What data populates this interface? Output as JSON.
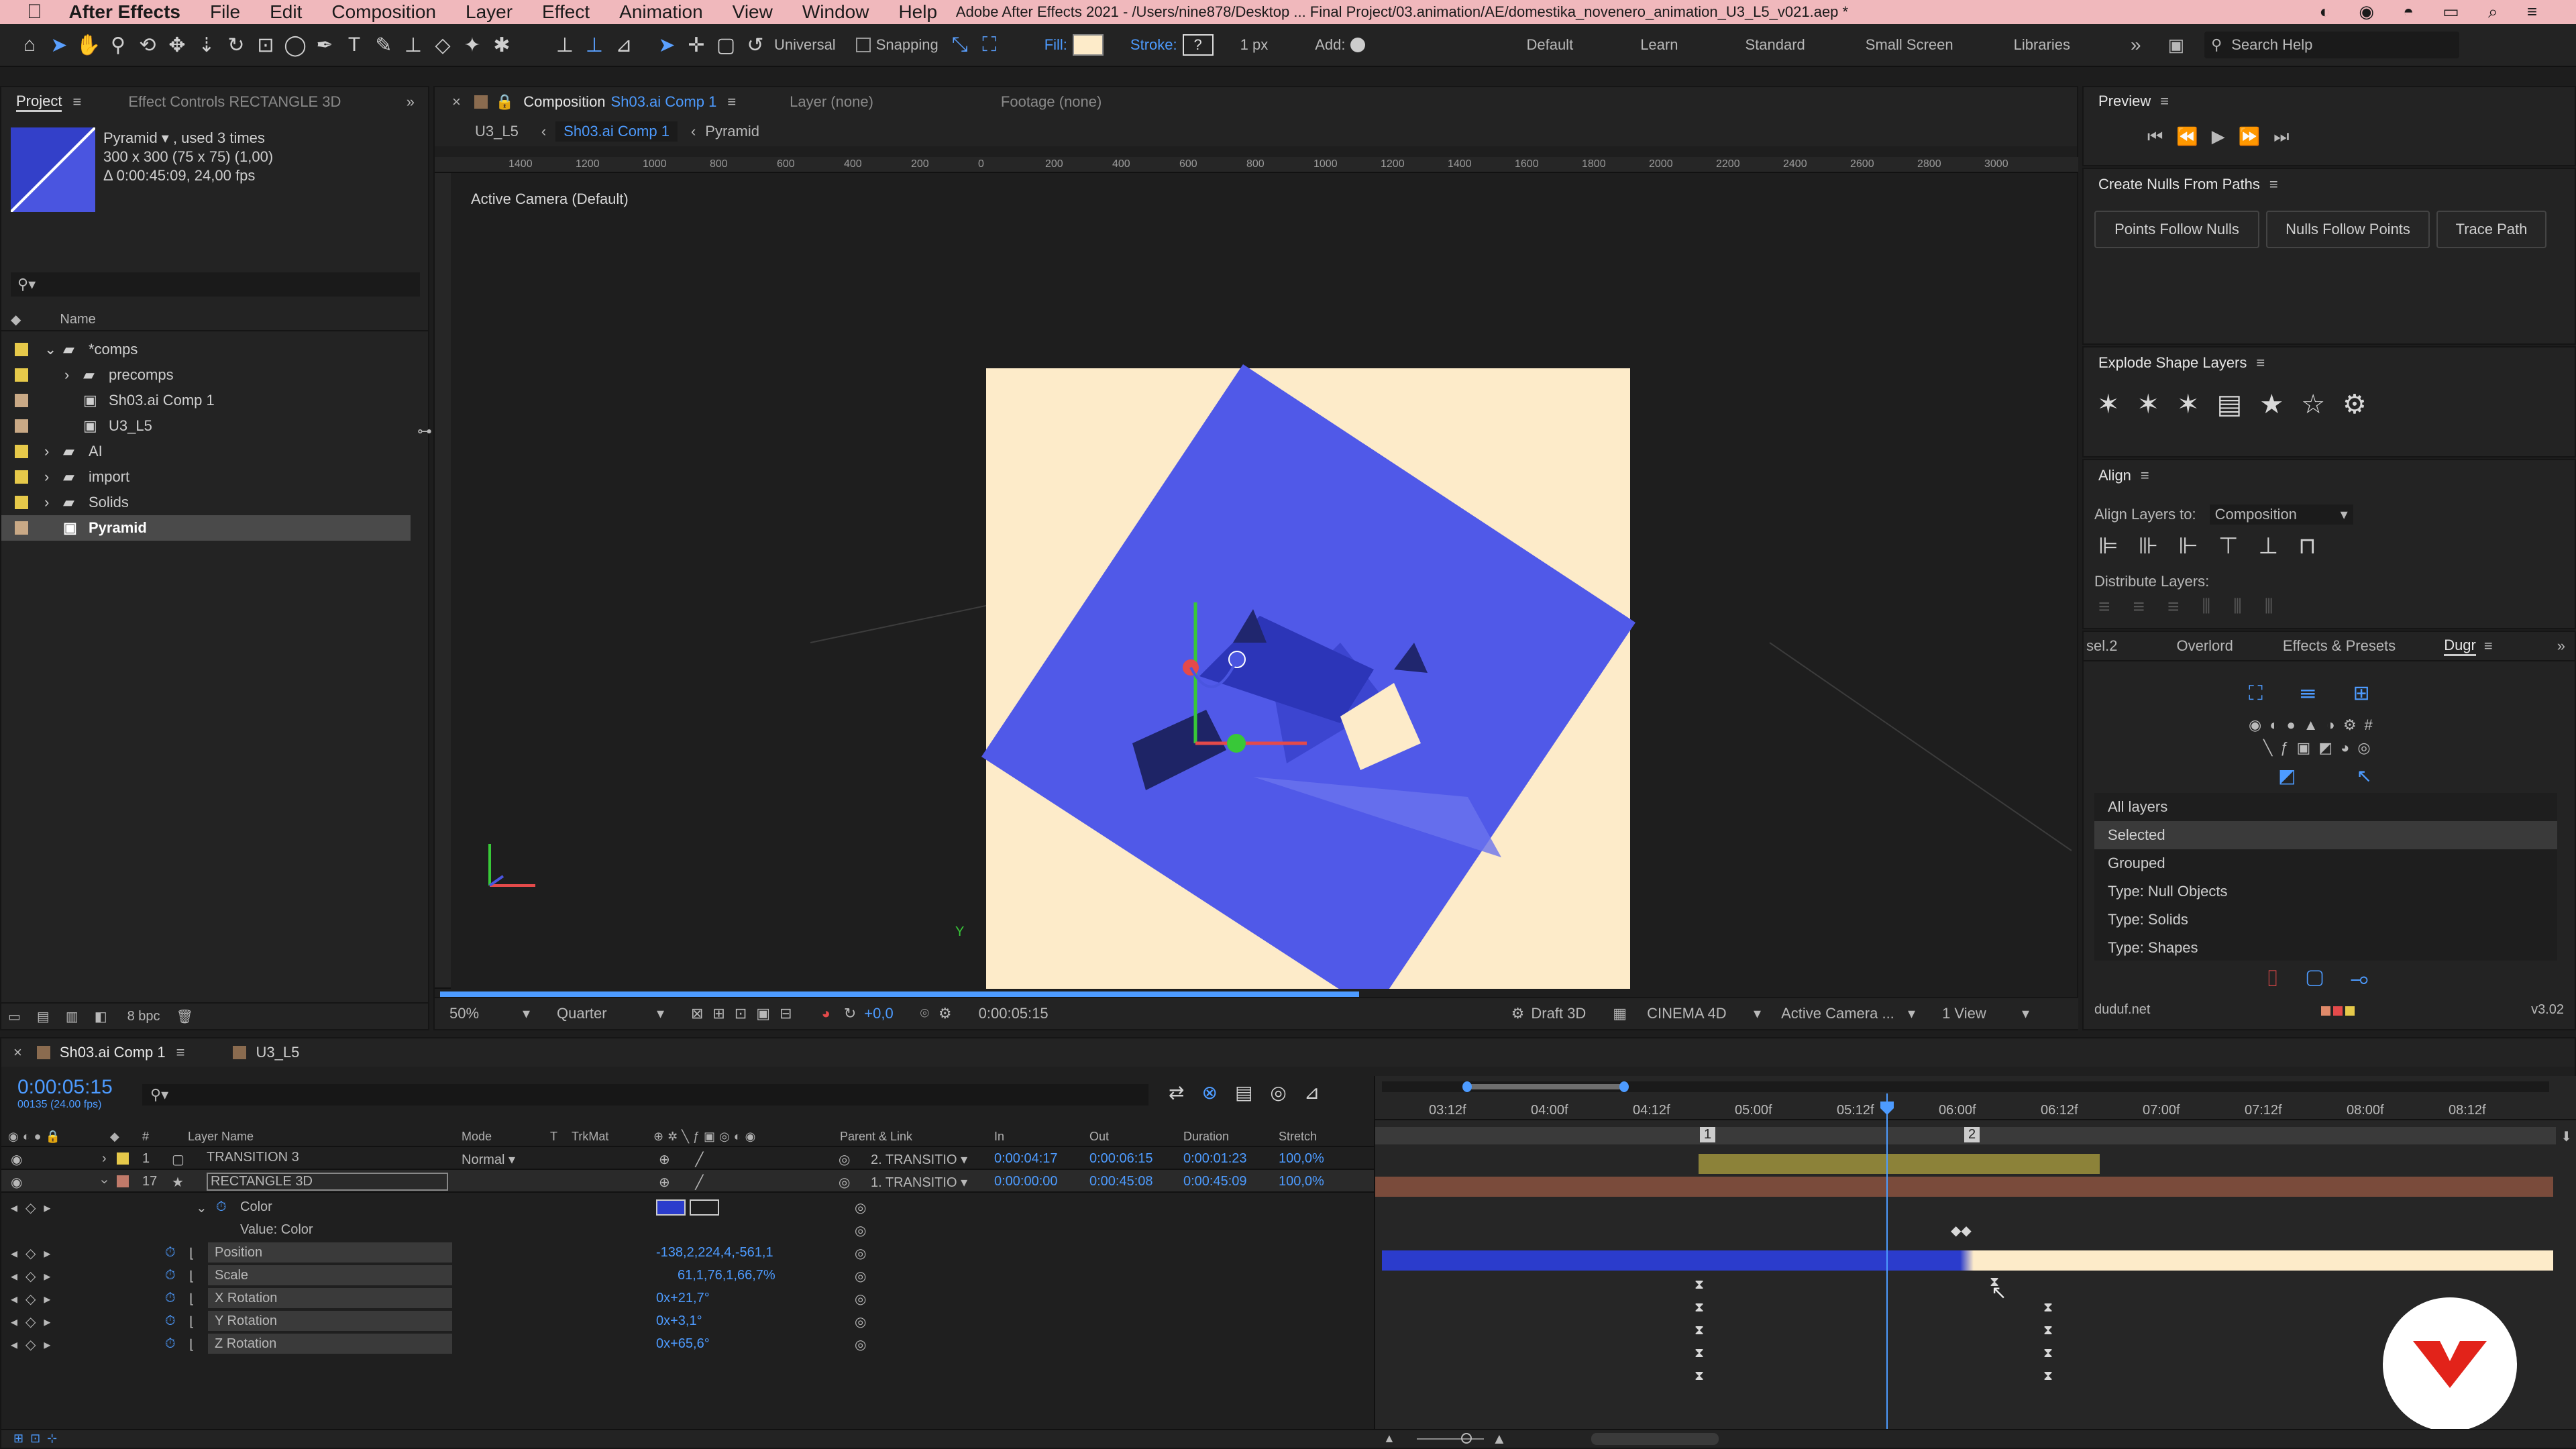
{
  "menubar": {
    "app": "After Effects",
    "items": [
      "File",
      "Edit",
      "Composition",
      "Layer",
      "Effect",
      "Animation",
      "View",
      "Window",
      "Help"
    ]
  },
  "toolbar": {
    "universal": "Universal",
    "snapping": "Snapping",
    "fill": "Fill:",
    "stroke": "Stroke:",
    "stroke_width": "1 px",
    "add": "Add:",
    "workspaces": [
      "Default",
      "Learn",
      "Standard",
      "Small Screen",
      "Libraries"
    ],
    "search": "Search Help"
  },
  "window_title": "Adobe After Effects 2021 - /Users/nine878/Desktop ... Final Project/03.animation/AE/domestika_novenero_animation_U3_L5_v021.aep *",
  "project": {
    "tab": "Project",
    "tab2": "Effect Controls RECTANGLE 3D",
    "item_name": "Pyramid ▾ , used 3 times",
    "item_size": "300 x 300  (75 x 75) (1,00)",
    "item_dur": "Δ 0:00:45:09, 24,00 fps",
    "col_name": "Name",
    "bpc": "8 bpc",
    "tree": [
      {
        "label": "*comps",
        "indent": 0,
        "type": "folder",
        "open": true
      },
      {
        "label": "precomps",
        "indent": 1,
        "type": "folder",
        "open": false
      },
      {
        "label": "Sh03.ai Comp 1",
        "indent": 1,
        "type": "comp"
      },
      {
        "label": "U3_L5",
        "indent": 1,
        "type": "comp"
      },
      {
        "label": "AI",
        "indent": 0,
        "type": "folder",
        "open": false
      },
      {
        "label": "import",
        "indent": 0,
        "type": "folder",
        "open": false
      },
      {
        "label": "Solids",
        "indent": 0,
        "type": "folder",
        "open": false
      },
      {
        "label": "Pyramid",
        "indent": 0,
        "type": "item",
        "selected": true
      }
    ]
  },
  "viewer": {
    "tab_prefix": "Composition",
    "tab_comp": "Sh03.ai Comp 1",
    "tab_layer": "Layer (none)",
    "tab_footage": "Footage (none)",
    "crumbs": [
      "U3_L5",
      "Sh03.ai Comp 1",
      "Pyramid"
    ],
    "camera_label": "Active Camera (Default)",
    "ruler": [
      "1400",
      "1200",
      "1000",
      "800",
      "600",
      "400",
      "200",
      "0",
      "200",
      "400",
      "600",
      "800",
      "1000",
      "1200",
      "1400",
      "1600",
      "1800",
      "2000",
      "2200",
      "2400",
      "2600",
      "2800",
      "3000"
    ],
    "bottom": {
      "zoom": "50%",
      "quality": "Quarter",
      "exposure": "+0,0",
      "time": "0:00:05:15",
      "draft": "Draft 3D",
      "renderer": "CINEMA 4D",
      "camera": "Active Camera ...",
      "views": "1 View"
    }
  },
  "right": {
    "preview": "Preview",
    "nulls": {
      "title": "Create Nulls From Paths",
      "btns": [
        "Points Follow Nulls",
        "Nulls Follow Points",
        "Trace Path"
      ]
    },
    "explode": "Explode Shape Layers",
    "align": {
      "title": "Align",
      "align_to_label": "Align Layers to:",
      "align_to": "Composition",
      "distribute": "Distribute Layers:"
    },
    "tabs": [
      "sel.2",
      "Overlord",
      "Effects & Presets",
      "Dugr"
    ],
    "dugr_list": [
      "All layers",
      "Selected",
      "Grouped",
      "Type: Null Objects",
      "Type: Solids",
      "Type: Shapes"
    ],
    "footer_left": "duduf.net",
    "footer_right": "v3.02"
  },
  "timeline": {
    "tab1": "Sh03.ai Comp 1",
    "tab2": "U3_L5",
    "timecode": "0:00:05:15",
    "fps": "00135 (24.00 fps)",
    "cols": {
      "num": "#",
      "name": "Layer Name",
      "mode": "Mode",
      "t": "T",
      "trkmat": "TrkMat",
      "parent": "Parent & Link",
      "in": "In",
      "out": "Out",
      "dur": "Duration",
      "stretch": "Stretch"
    },
    "layers": [
      {
        "num": "1",
        "name": "TRANSITION 3",
        "mode": "Normal",
        "parent": "2. TRANSITIO",
        "in": "0:00:04:17",
        "out": "0:00:06:15",
        "dur": "0:00:01:23",
        "stretch": "100,0%"
      },
      {
        "num": "17",
        "name": "RECTANGLE 3D",
        "mode": "",
        "parent": "1. TRANSITIO",
        "in": "0:00:00:00",
        "out": "0:00:45:08",
        "dur": "0:00:45:09",
        "stretch": "100,0%"
      }
    ],
    "props": [
      {
        "name": "Color",
        "value": ""
      },
      {
        "name": "Value: Color",
        "value": ""
      },
      {
        "name": "Position",
        "value": "-138,2,224,4,-561,1"
      },
      {
        "name": "Scale",
        "value": "61,1,76,1,66,7%"
      },
      {
        "name": "X Rotation",
        "value": "0x+21,7°"
      },
      {
        "name": "Y Rotation",
        "value": "0x+3,1°"
      },
      {
        "name": "Z Rotation",
        "value": "0x+65,6°"
      }
    ],
    "ticks": [
      "03:12f",
      "04:00f",
      "04:12f",
      "05:00f",
      "05:12f",
      "06:00f",
      "06:12f",
      "07:00f",
      "07:12f",
      "08:00f",
      "08:12f"
    ],
    "markers": [
      "1",
      "2"
    ]
  },
  "colors": {
    "accent": "#4d9bff",
    "comp_bg": "#fdebc9",
    "rect": "#5059e8",
    "layer_olive": "#8c8239",
    "layer_brown": "#7a4b3b",
    "color_bar": "#2b3ccc"
  }
}
